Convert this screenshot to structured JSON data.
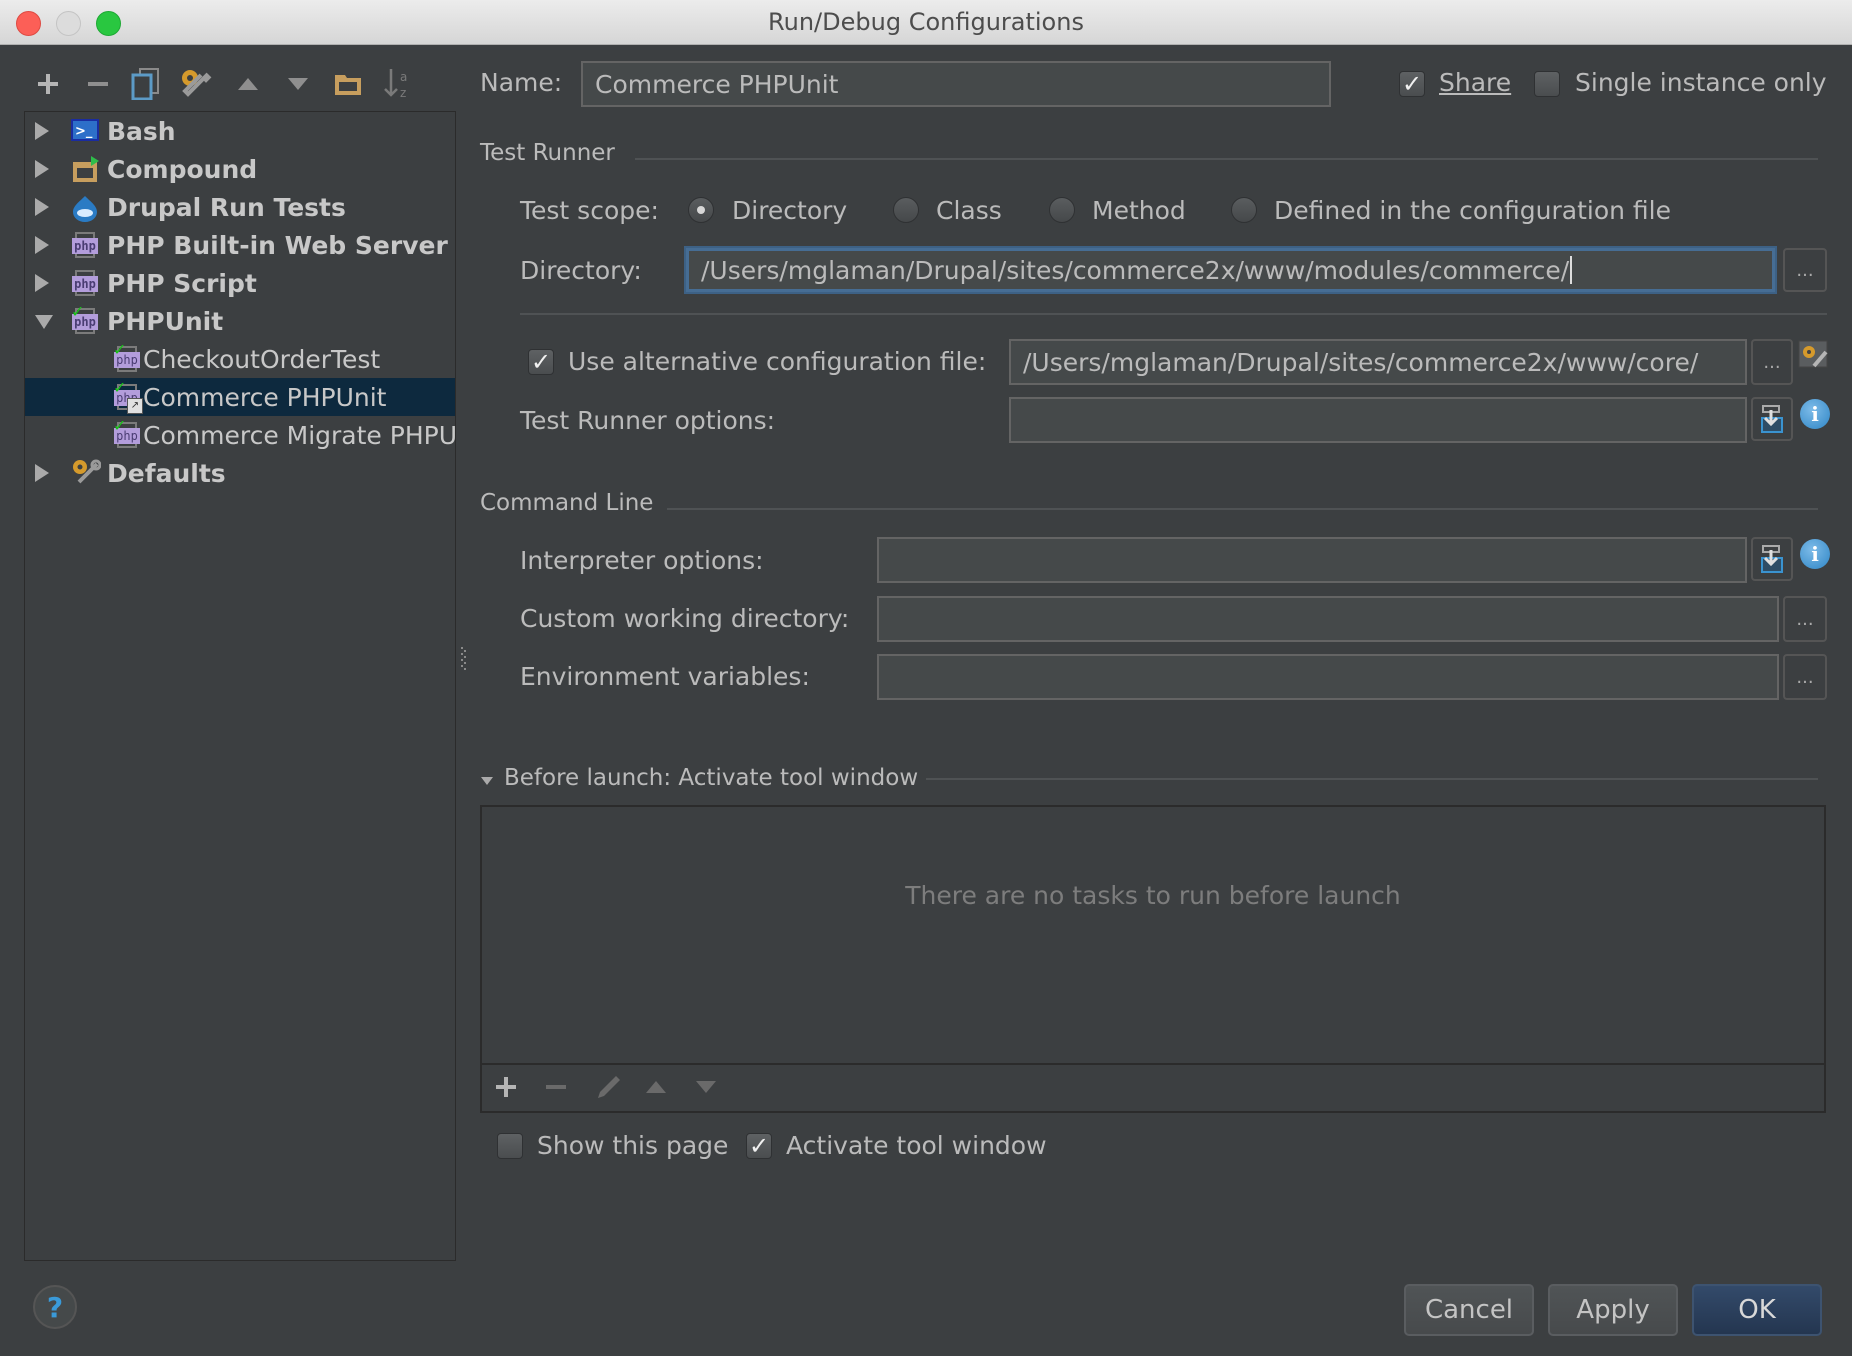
{
  "window": {
    "title": "Run/Debug Configurations"
  },
  "toolbar": {
    "icons": [
      "add-icon",
      "remove-icon",
      "copy-icon",
      "edit-defaults-icon",
      "move-up-icon",
      "move-down-icon",
      "folder-icon",
      "sort-alpha-icon"
    ]
  },
  "tree": {
    "items": [
      {
        "label": "Bash",
        "level": 0,
        "expanded": false,
        "icon": "bash-icon"
      },
      {
        "label": "Compound",
        "level": 0,
        "expanded": false,
        "icon": "compound-icon"
      },
      {
        "label": "Drupal Run Tests",
        "level": 0,
        "expanded": false,
        "icon": "drupal-icon"
      },
      {
        "label": "PHP Built-in Web Server",
        "level": 0,
        "expanded": false,
        "icon": "php-web-server-icon"
      },
      {
        "label": "PHP Script",
        "level": 0,
        "expanded": false,
        "icon": "php-script-icon"
      },
      {
        "label": "PHPUnit",
        "level": 0,
        "expanded": true,
        "icon": "phpunit-icon"
      },
      {
        "label": "CheckoutOrderTest",
        "level": 1,
        "icon": "phpunit-icon"
      },
      {
        "label": "Commerce PHPUnit",
        "level": 1,
        "icon": "phpunit-shared-icon",
        "selected": true
      },
      {
        "label": "Commerce Migrate PHPUnit",
        "level": 1,
        "icon": "phpunit-icon"
      },
      {
        "label": "Defaults",
        "level": 0,
        "expanded": false,
        "icon": "defaults-icon"
      }
    ]
  },
  "form": {
    "name_label": "Name:",
    "name_value": "Commerce PHPUnit",
    "share_label": "Share",
    "share_checked": true,
    "single_instance_label": "Single instance only",
    "single_instance_checked": false,
    "test_runner": {
      "section_title": "Test Runner",
      "scope_label": "Test scope:",
      "scope_options": [
        "Directory",
        "Class",
        "Method",
        "Defined in the configuration file"
      ],
      "scope_selected": "Directory",
      "directory_label": "Directory:",
      "directory_value": "/Users/mglaman/Drupal/sites/commerce2x/www/modules/commerce/",
      "alt_config_label": "Use alternative configuration file:",
      "alt_config_checked": true,
      "alt_config_value": "/Users/mglaman/Drupal/sites/commerce2x/www/core/",
      "runner_options_label": "Test Runner options:",
      "runner_options_value": ""
    },
    "command_line": {
      "section_title": "Command Line",
      "interpreter_label": "Interpreter options:",
      "interpreter_value": "",
      "working_dir_label": "Custom working directory:",
      "working_dir_value": "",
      "env_label": "Environment variables:",
      "env_value": ""
    },
    "before_launch": {
      "section_title": "Before launch: Activate tool window",
      "empty_text": "There are no tasks to run before launch",
      "show_page_label": "Show this page",
      "show_page_checked": false,
      "activate_label": "Activate tool window",
      "activate_checked": true
    }
  },
  "footer": {
    "help_label": "?",
    "cancel_label": "Cancel",
    "apply_label": "Apply",
    "ok_label": "OK"
  },
  "glyphs": {
    "dots": "...",
    "check": "✓",
    "info": "i"
  },
  "colors": {
    "background": "#3c3f41",
    "selection": "#0d293e",
    "focus": "#466d94",
    "primary_button": "#2b3f5c"
  }
}
